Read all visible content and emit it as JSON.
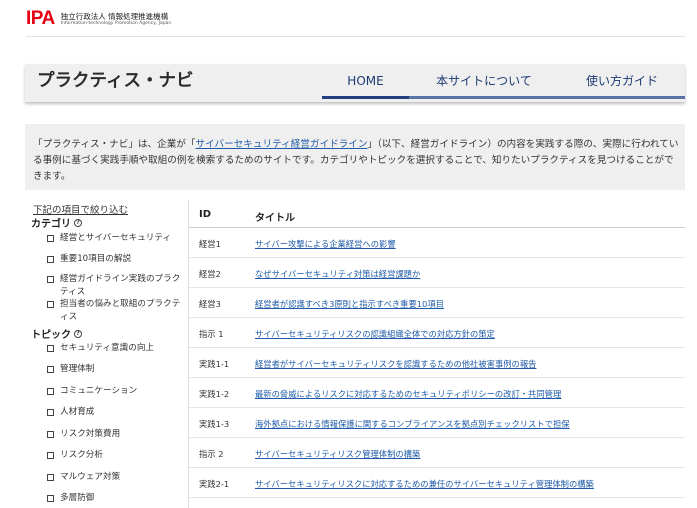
{
  "brand": {
    "logo": "IPA",
    "name_jp": "独立行政法人 情報処理推進機構",
    "name_en": "Information-technology Promotion Agency, Japan"
  },
  "header": {
    "title": "プラクティス・ナビ",
    "nav": [
      "HOME",
      "本サイトについて",
      "使い方ガイド"
    ]
  },
  "intro": {
    "before": "「プラクティス・ナビ」は、企業が「",
    "link": "サイバーセキュリティ経営ガイドライン",
    "after": "」（以下、経営ガイドライン）の内容を実践する際の、実際に行われている事例に基づく実践手順や取組の例を検索するためのサイトです。カテゴリやトピックを選択することで、知りたいプラクティスを見つけることができます。"
  },
  "sidebar": {
    "filter_link": "下記の項目で絞り込む",
    "category_heading": "カテゴリ",
    "categories": [
      "経営とサイバーセキュリティ",
      "重要10項目の解説",
      "経営ガイドライン実践のプラクティス",
      "担当者の悩みと取組のプラクティス"
    ],
    "topic_heading": "トピック",
    "topics": [
      "セキュリティ意識の向上",
      "管理体制",
      "コミュニケーション",
      "人材育成",
      "リスク対策費用",
      "リスク分析",
      "マルウェア対策",
      "多層防御"
    ],
    "help_glyph": "?"
  },
  "table": {
    "col_id": "ID",
    "col_title": "タイトル",
    "rows": [
      {
        "id": "経営1",
        "title": "サイバー攻撃による企業経営への影響"
      },
      {
        "id": "経営2",
        "title": "なぜサイバーセキュリティ対策は経営課題か"
      },
      {
        "id": "経営3",
        "title": "経営者が認識すべき3原則と指示すべき重要10項目"
      },
      {
        "id": "指示 1",
        "title": "サイバーセキュリティリスクの認識組織全体での対応方針の策定"
      },
      {
        "id": "実践1-1",
        "title": "経営者がサイバーセキュリティリスクを認識するための他社被害事例の報告"
      },
      {
        "id": "実践1-2",
        "title": "最新の脅威によるリスクに対応するためのセキュリティポリシーの改訂・共同管理"
      },
      {
        "id": "実践1-3",
        "title": "海外拠点における情報保護に関するコンプライアンスを拠点別チェックリストで担保"
      },
      {
        "id": "指示 2",
        "title": "サイバーセキュリティリスク管理体制の構築"
      },
      {
        "id": "実践2-1",
        "title": "サイバーセキュリティリスクに対応するための兼任のサイバーセキュリティ管理体制の構築"
      }
    ]
  }
}
